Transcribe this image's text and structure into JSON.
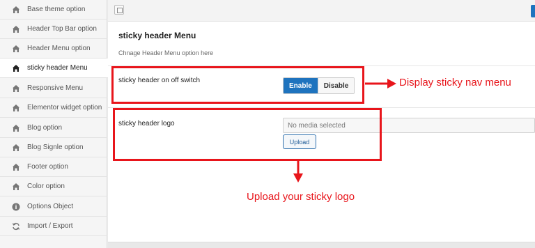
{
  "sidebar": {
    "items": [
      {
        "label": "Base theme option",
        "icon": "home-icon"
      },
      {
        "label": "Header Top Bar option",
        "icon": "home-icon"
      },
      {
        "label": "Header Menu option",
        "icon": "home-icon"
      },
      {
        "label": "sticky header Menu",
        "icon": "home-icon",
        "active": true
      },
      {
        "label": "Responsive Menu",
        "icon": "home-icon"
      },
      {
        "label": "Elementor widget option",
        "icon": "home-icon"
      },
      {
        "label": "Blog option",
        "icon": "home-icon"
      },
      {
        "label": "Blog Signle option",
        "icon": "home-icon"
      },
      {
        "label": "Footer option",
        "icon": "home-icon"
      },
      {
        "label": "Color option",
        "icon": "home-icon"
      },
      {
        "label": "Options Object",
        "icon": "info-icon"
      },
      {
        "label": "Import / Export",
        "icon": "refresh-icon"
      }
    ]
  },
  "main": {
    "section_title": "sticky header Menu",
    "section_desc": "Chnage Header Menu option here",
    "switch": {
      "label": "sticky header on off switch",
      "enable_label": "Enable",
      "disable_label": "Disable",
      "selected": "Enable"
    },
    "logo": {
      "label": "sticky header logo",
      "placeholder": "No media selected",
      "upload_label": "Upload"
    }
  },
  "annotations": {
    "switch_note": "Display sticky nav menu",
    "logo_note": "Upload your sticky logo"
  },
  "colors": {
    "accent": "#1e73be",
    "annotation": "#e8151b"
  }
}
